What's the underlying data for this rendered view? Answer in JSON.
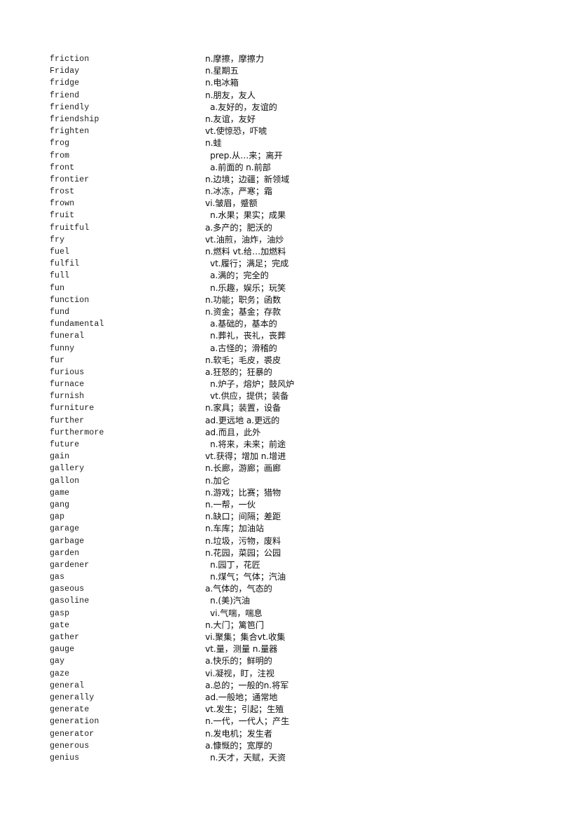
{
  "document": {
    "type": "vocabulary-list",
    "language_pair": "English-Chinese",
    "entries": [
      {
        "term": "friction",
        "definition": "n.摩擦，摩擦力",
        "indent": false
      },
      {
        "term": "Friday",
        "definition": "n.星期五",
        "indent": false
      },
      {
        "term": "fridge",
        "definition": "n.电冰箱",
        "indent": false
      },
      {
        "term": "friend",
        "definition": "n.朋友，友人",
        "indent": false
      },
      {
        "term": "friendly",
        "definition": "a.友好的，友谊的",
        "indent": true
      },
      {
        "term": "friendship",
        "definition": "n.友谊，友好",
        "indent": false
      },
      {
        "term": "frighten",
        "definition": "vt.使惊恐，吓唬",
        "indent": false
      },
      {
        "term": "frog",
        "definition": "n.蛙",
        "indent": false
      },
      {
        "term": "from",
        "definition": "prep.从…来；离开",
        "indent": true
      },
      {
        "term": "front",
        "definition": "a.前面的 n.前部",
        "indent": true
      },
      {
        "term": "frontier",
        "definition": "n.边境；边疆；新领域",
        "indent": false
      },
      {
        "term": "frost",
        "definition": "n.冰冻，严寒；霜",
        "indent": false
      },
      {
        "term": "frown",
        "definition": "vi.皱眉，蹙额",
        "indent": false
      },
      {
        "term": "fruit",
        "definition": "n.水果；果实；成果",
        "indent": true
      },
      {
        "term": "fruitful",
        "definition": "a.多产的；肥沃的",
        "indent": false
      },
      {
        "term": "fry",
        "definition": "vt.油煎，油炸，油炒",
        "indent": false
      },
      {
        "term": "fuel",
        "definition": "n.燃料 vt.给…加燃料",
        "indent": false
      },
      {
        "term": "fulfil",
        "definition": "vt.履行；满足；完成",
        "indent": true
      },
      {
        "term": "full",
        "definition": "a.满的；完全的",
        "indent": true
      },
      {
        "term": "fun",
        "definition": "n.乐趣，娱乐；玩笑",
        "indent": true
      },
      {
        "term": "function",
        "definition": "n.功能；职务；函数",
        "indent": false
      },
      {
        "term": "fund",
        "definition": "n.资金；基金；存款",
        "indent": false
      },
      {
        "term": "fundamental",
        "definition": "a.基础的，基本的",
        "indent": true
      },
      {
        "term": "funeral",
        "definition": "n.葬礼，丧礼，丧葬",
        "indent": true
      },
      {
        "term": "funny",
        "definition": "a.古怪的；滑稽的",
        "indent": true
      },
      {
        "term": "fur",
        "definition": "n.软毛；毛皮，裘皮",
        "indent": false
      },
      {
        "term": "furious",
        "definition": "a.狂怒的；狂暴的",
        "indent": false
      },
      {
        "term": "furnace",
        "definition": "n.炉子，熔炉；鼓风炉",
        "indent": true
      },
      {
        "term": "furnish",
        "definition": "vt.供应，提供；装备",
        "indent": true
      },
      {
        "term": "furniture",
        "definition": "n.家具；装置，设备",
        "indent": false
      },
      {
        "term": "further",
        "definition": "ad.更远地 a.更远的",
        "indent": false
      },
      {
        "term": "furthermore",
        "definition": "ad.而且，此外",
        "indent": false
      },
      {
        "term": "future",
        "definition": "n.将来，未来；前途",
        "indent": true
      },
      {
        "term": "gain",
        "definition": "vt.获得；增加 n.增进",
        "indent": false
      },
      {
        "term": "gallery",
        "definition": "n.长廊，游廊；画廊",
        "indent": false
      },
      {
        "term": "gallon",
        "definition": "n.加仑",
        "indent": false
      },
      {
        "term": "game",
        "definition": "n.游戏；比赛；猎物",
        "indent": false
      },
      {
        "term": "gang",
        "definition": "n.一帮，一伙",
        "indent": false
      },
      {
        "term": "gap",
        "definition": "n.缺口；间隔；差距",
        "indent": false
      },
      {
        "term": "garage",
        "definition": "n.车库；加油站",
        "indent": false
      },
      {
        "term": "garbage",
        "definition": "n.垃圾，污物，废料",
        "indent": false
      },
      {
        "term": "garden",
        "definition": "n.花园，菜园；公园",
        "indent": false
      },
      {
        "term": "gardener",
        "definition": "n.园丁，花匠",
        "indent": true
      },
      {
        "term": "gas",
        "definition": "n.煤气；气体；汽油",
        "indent": true
      },
      {
        "term": "gaseous",
        "definition": "a.气体的，气态的",
        "indent": false
      },
      {
        "term": "gasoline",
        "definition": "n.(美)汽油",
        "indent": true
      },
      {
        "term": "gasp",
        "definition": "vi.气喘，喘息",
        "indent": true
      },
      {
        "term": "gate",
        "definition": "n.大门；篱笆门",
        "indent": false
      },
      {
        "term": "gather",
        "definition": "vi.聚集；集合vt.收集",
        "indent": false
      },
      {
        "term": "gauge",
        "definition": "vt.量，测量 n.量器",
        "indent": false
      },
      {
        "term": "gay",
        "definition": "a.快乐的；鲜明的",
        "indent": false
      },
      {
        "term": "gaze",
        "definition": "vi.凝视，盯，注视",
        "indent": false
      },
      {
        "term": "general",
        "definition": "a.总的；一般的n.将军",
        "indent": false
      },
      {
        "term": "generally",
        "definition": "ad.一般地；通常地",
        "indent": false
      },
      {
        "term": "generate",
        "definition": "vt.发生；引起；生殖",
        "indent": false
      },
      {
        "term": "generation",
        "definition": "n.一代，一代人；产生",
        "indent": false
      },
      {
        "term": "generator",
        "definition": "n.发电机；发生者",
        "indent": false
      },
      {
        "term": "generous",
        "definition": "a.慷慨的；宽厚的",
        "indent": false
      },
      {
        "term": "genius",
        "definition": "n.天才，天赋，天资",
        "indent": true
      }
    ]
  }
}
